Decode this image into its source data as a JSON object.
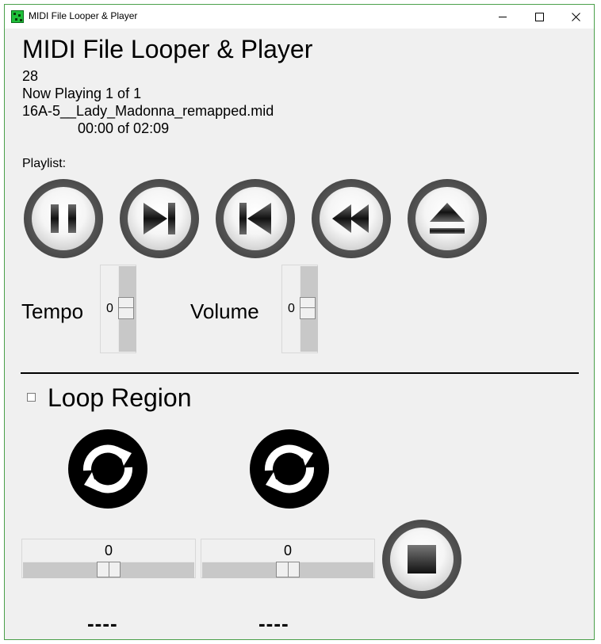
{
  "window": {
    "title": "MIDI File Looper & Player"
  },
  "header": {
    "title": "MIDI File Looper & Player",
    "count": "28",
    "now_playing": "Now Playing 1 of 1",
    "filename": "16A-5__Lady_Madonna_remapped.mid",
    "time": "00:00 of 02:09"
  },
  "playlist": {
    "label": "Playlist:"
  },
  "transport_icons": [
    "pause-icon",
    "next-track-icon",
    "previous-track-icon",
    "rewind-icon",
    "eject-icon"
  ],
  "sliders": {
    "tempo": {
      "label": "Tempo",
      "value": "0"
    },
    "volume": {
      "label": "Volume",
      "value": "0"
    }
  },
  "loop": {
    "label": "Loop Region",
    "checked": false,
    "start_slider_value": "0",
    "end_slider_value": "0",
    "start_display": "----",
    "end_display": "----"
  },
  "colors": {
    "window_border": "#4aa04a",
    "background": "#f0f0f0",
    "app_icon": "#1fbf3a"
  }
}
